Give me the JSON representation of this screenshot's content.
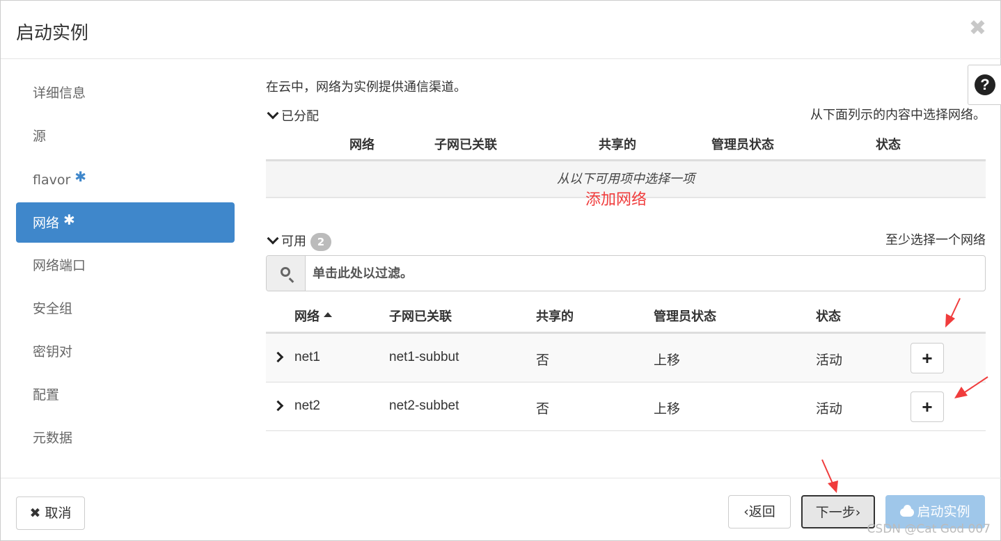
{
  "modal": {
    "title": "启动实例",
    "close_glyph": "✖"
  },
  "help": {
    "glyph": "?"
  },
  "nav": {
    "items": [
      {
        "label": "详细信息",
        "required": false,
        "active": false
      },
      {
        "label": "源",
        "required": false,
        "active": false
      },
      {
        "label": "flavor",
        "required": true,
        "active": false
      },
      {
        "label": "网络",
        "required": true,
        "active": true
      },
      {
        "label": "网络端口",
        "required": false,
        "active": false
      },
      {
        "label": "安全组",
        "required": false,
        "active": false
      },
      {
        "label": "密钥对",
        "required": false,
        "active": false
      },
      {
        "label": "配置",
        "required": false,
        "active": false
      },
      {
        "label": "元数据",
        "required": false,
        "active": false
      }
    ],
    "required_glyph": "✱"
  },
  "content": {
    "intro": "在云中，网络为实例提供通信渠道。",
    "allocated": {
      "title": "已分配",
      "hint": "从下面列示的内容中选择网络。",
      "columns": [
        "网络",
        "子网已关联",
        "共享的",
        "管理员状态",
        "状态"
      ],
      "empty_text": "从以下可用项中选择一项"
    },
    "available": {
      "title": "可用",
      "count": "2",
      "hint": "至少选择一个网络",
      "filter_placeholder": "单击此处以过滤。",
      "columns": [
        "网络",
        "子网已关联",
        "共享的",
        "管理员状态",
        "状态"
      ],
      "rows": [
        {
          "network": "net1",
          "subnet": "net1-subbut",
          "shared": "否",
          "admin_state": "上移",
          "status": "活动",
          "add": "+"
        },
        {
          "network": "net2",
          "subnet": "net2-subbet",
          "shared": "否",
          "admin_state": "上移",
          "status": "活动",
          "add": "+"
        }
      ]
    }
  },
  "annotation": {
    "text": "添加网络",
    "color": "#f03c3c"
  },
  "footer": {
    "cancel": "取消",
    "cancel_glyph": "✖",
    "back": "返回",
    "back_glyph": "‹",
    "next": "下一步",
    "next_glyph": "›",
    "launch": "启动实例"
  },
  "watermark": "CSDN @Cat God 007",
  "colors": {
    "accent": "#3f87cb",
    "launch_disabled": "#9fc7ea",
    "annotation": "#f03c3c"
  }
}
